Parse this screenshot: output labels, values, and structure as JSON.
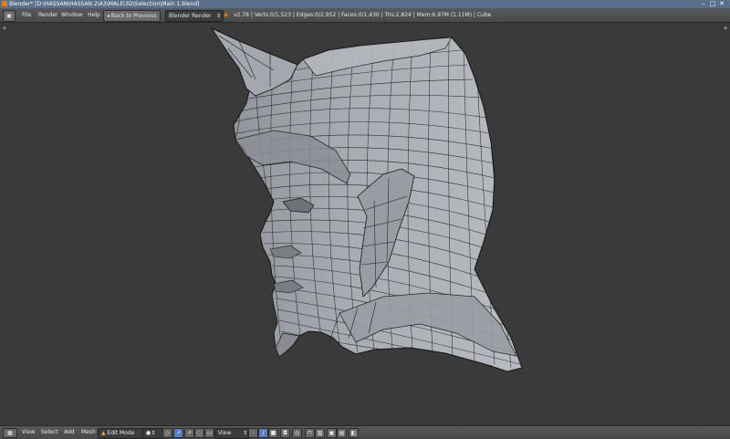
{
  "titlebar": {
    "title": "Blender* [D:\\HASSAN\\HASSAN 2\\A3\\MALE\\3D\\Selection\\Main 1.blend]",
    "minimize": "–",
    "maximize": "□",
    "close": "✕"
  },
  "menu": {
    "items": [
      "File",
      "Render",
      "Window",
      "Help"
    ],
    "back_button": "Back to Previous",
    "render_engine": "Blender Render",
    "stats": "v2.78 | Verts:0/1,523 | Edges:0/2,952 | Faces:0/1,430 | Tris:2,824 | Mem:6.97M (1.11M) | Cube"
  },
  "viewport": {
    "object": "Cube",
    "mode": "Edit Mode",
    "colors": {
      "background": "#393939",
      "mesh_face": "#a7aab0",
      "mesh_wire": "#1a1a1a"
    }
  },
  "bottom": {
    "view": "View",
    "select": "Select",
    "add": "Add",
    "mesh": "Mesh",
    "mode": "Edit Mode",
    "pivot_view": "View"
  },
  "icons": {
    "editor_type": "3d-view-icon",
    "blender": "blender-logo-icon",
    "viewport_shading": "solid-sphere-icon"
  }
}
